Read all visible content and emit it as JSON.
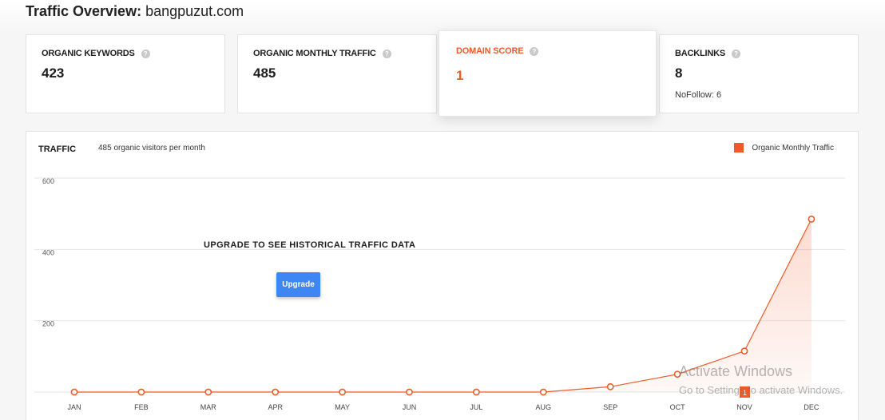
{
  "header": {
    "title_bold": "Traffic Overview:",
    "domain": "bangpuzut.com"
  },
  "cards": [
    {
      "label": "ORGANIC KEYWORDS",
      "value": "423"
    },
    {
      "label": "ORGANIC MONTHLY TRAFFIC",
      "value": "485"
    },
    {
      "label": "DOMAIN SCORE",
      "value": "1"
    },
    {
      "label": "BACKLINKS",
      "value": "8",
      "sub": "NoFollow: 6"
    }
  ],
  "help_glyph": "?",
  "traffic": {
    "title": "TRAFFIC",
    "subtitle": "485 organic visitors per month",
    "legend": "Organic Monthly Traffic",
    "upgrade_message": "UPGRADE TO SEE HISTORICAL TRAFFIC DATA",
    "upgrade_button": "Upgrade",
    "marker_badge": "1"
  },
  "colors": {
    "accent": "#f05a28",
    "button": "#3f86f5"
  },
  "chart_data": {
    "type": "area",
    "categories": [
      "JAN",
      "FEB",
      "MAR",
      "APR",
      "MAY",
      "JUN",
      "JUL",
      "AUG",
      "SEP",
      "OCT",
      "NOV",
      "DEC"
    ],
    "series": [
      {
        "name": "Organic Monthly Traffic",
        "values": [
          0,
          0,
          0,
          0,
          0,
          0,
          0,
          0,
          15,
          50,
          115,
          485
        ]
      }
    ],
    "yticks": [
      200,
      400,
      600
    ],
    "ylim": [
      0,
      600
    ],
    "grid": true,
    "legend_position": "top-right"
  },
  "watermark": {
    "title": "Activate Windows",
    "subtitle": "Go to Settings to activate Windows."
  }
}
